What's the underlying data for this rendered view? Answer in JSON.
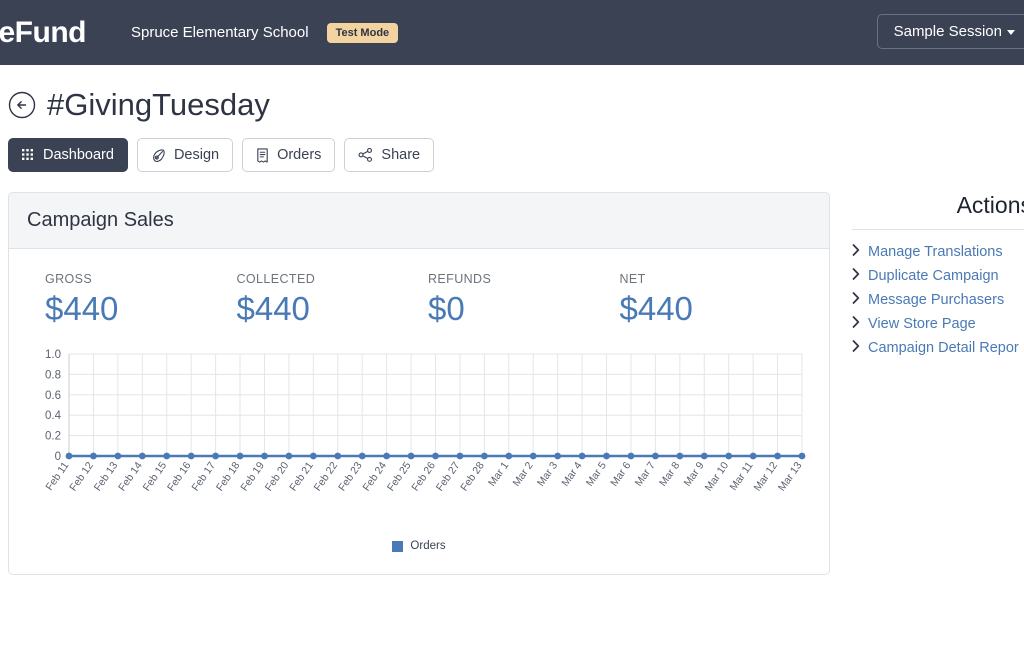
{
  "navbar": {
    "logo_text": "tureFund",
    "org_name": "Spruce Elementary School",
    "test_mode_badge": "Test Mode",
    "session_button": "Sample Session",
    "caret_icon": "caret-down-icon"
  },
  "page": {
    "back_icon": "back-arrow-circle-icon",
    "title": "#GivingTuesday"
  },
  "tabs": [
    {
      "label": "Dashboard",
      "icon": "dashboard-grid-icon",
      "active": true
    },
    {
      "label": "Design",
      "icon": "pen-design-icon",
      "active": false
    },
    {
      "label": "Orders",
      "icon": "receipt-orders-icon",
      "active": false
    },
    {
      "label": "Share",
      "icon": "share-nodes-icon",
      "active": false
    }
  ],
  "card": {
    "title": "Campaign Sales",
    "stats": [
      {
        "label": "GROSS",
        "value": "$440"
      },
      {
        "label": "COLLECTED",
        "value": "$440"
      },
      {
        "label": "REFUNDS",
        "value": "$0"
      },
      {
        "label": "NET",
        "value": "$440"
      }
    ]
  },
  "actions": {
    "title": "Actions",
    "items": [
      {
        "label": "Manage Translations",
        "icon": "chevron-right-icon"
      },
      {
        "label": "Duplicate Campaign",
        "icon": "chevron-right-icon"
      },
      {
        "label": "Message Purchasers",
        "icon": "chevron-right-icon"
      },
      {
        "label": "View Store Page",
        "icon": "chevron-right-icon"
      },
      {
        "label": "Campaign Detail Repor",
        "icon": "chevron-right-icon"
      }
    ]
  },
  "chart_data": {
    "type": "line",
    "title": "",
    "xlabel": "",
    "ylabel": "",
    "ylim": [
      0,
      1.0
    ],
    "yticks": [
      "0",
      "0.2",
      "0.4",
      "0.6",
      "0.8",
      "1.0"
    ],
    "ytick_values": [
      0,
      0.2,
      0.4,
      0.6,
      0.8,
      1.0
    ],
    "grid": true,
    "legend_position": "bottom",
    "line_color": "#4a7ab5",
    "marker": "circle",
    "categories": [
      "Feb 11",
      "Feb 12",
      "Feb 13",
      "Feb 14",
      "Feb 15",
      "Feb 16",
      "Feb 17",
      "Feb 18",
      "Feb 19",
      "Feb 20",
      "Feb 21",
      "Feb 22",
      "Feb 23",
      "Feb 24",
      "Feb 25",
      "Feb 26",
      "Feb 27",
      "Feb 28",
      "Mar 1",
      "Mar 2",
      "Mar 3",
      "Mar 4",
      "Mar 5",
      "Mar 6",
      "Mar 7",
      "Mar 8",
      "Mar 9",
      "Mar 10",
      "Mar 11",
      "Mar 12",
      "Mar 13"
    ],
    "series": [
      {
        "name": "Orders",
        "color": "#4a7ab5",
        "values": [
          0,
          0,
          0,
          0,
          0,
          0,
          0,
          0,
          0,
          0,
          0,
          0,
          0,
          0,
          0,
          0,
          0,
          0,
          0,
          0,
          0,
          0,
          0,
          0,
          0,
          0,
          0,
          0,
          0,
          0,
          0
        ]
      }
    ]
  }
}
